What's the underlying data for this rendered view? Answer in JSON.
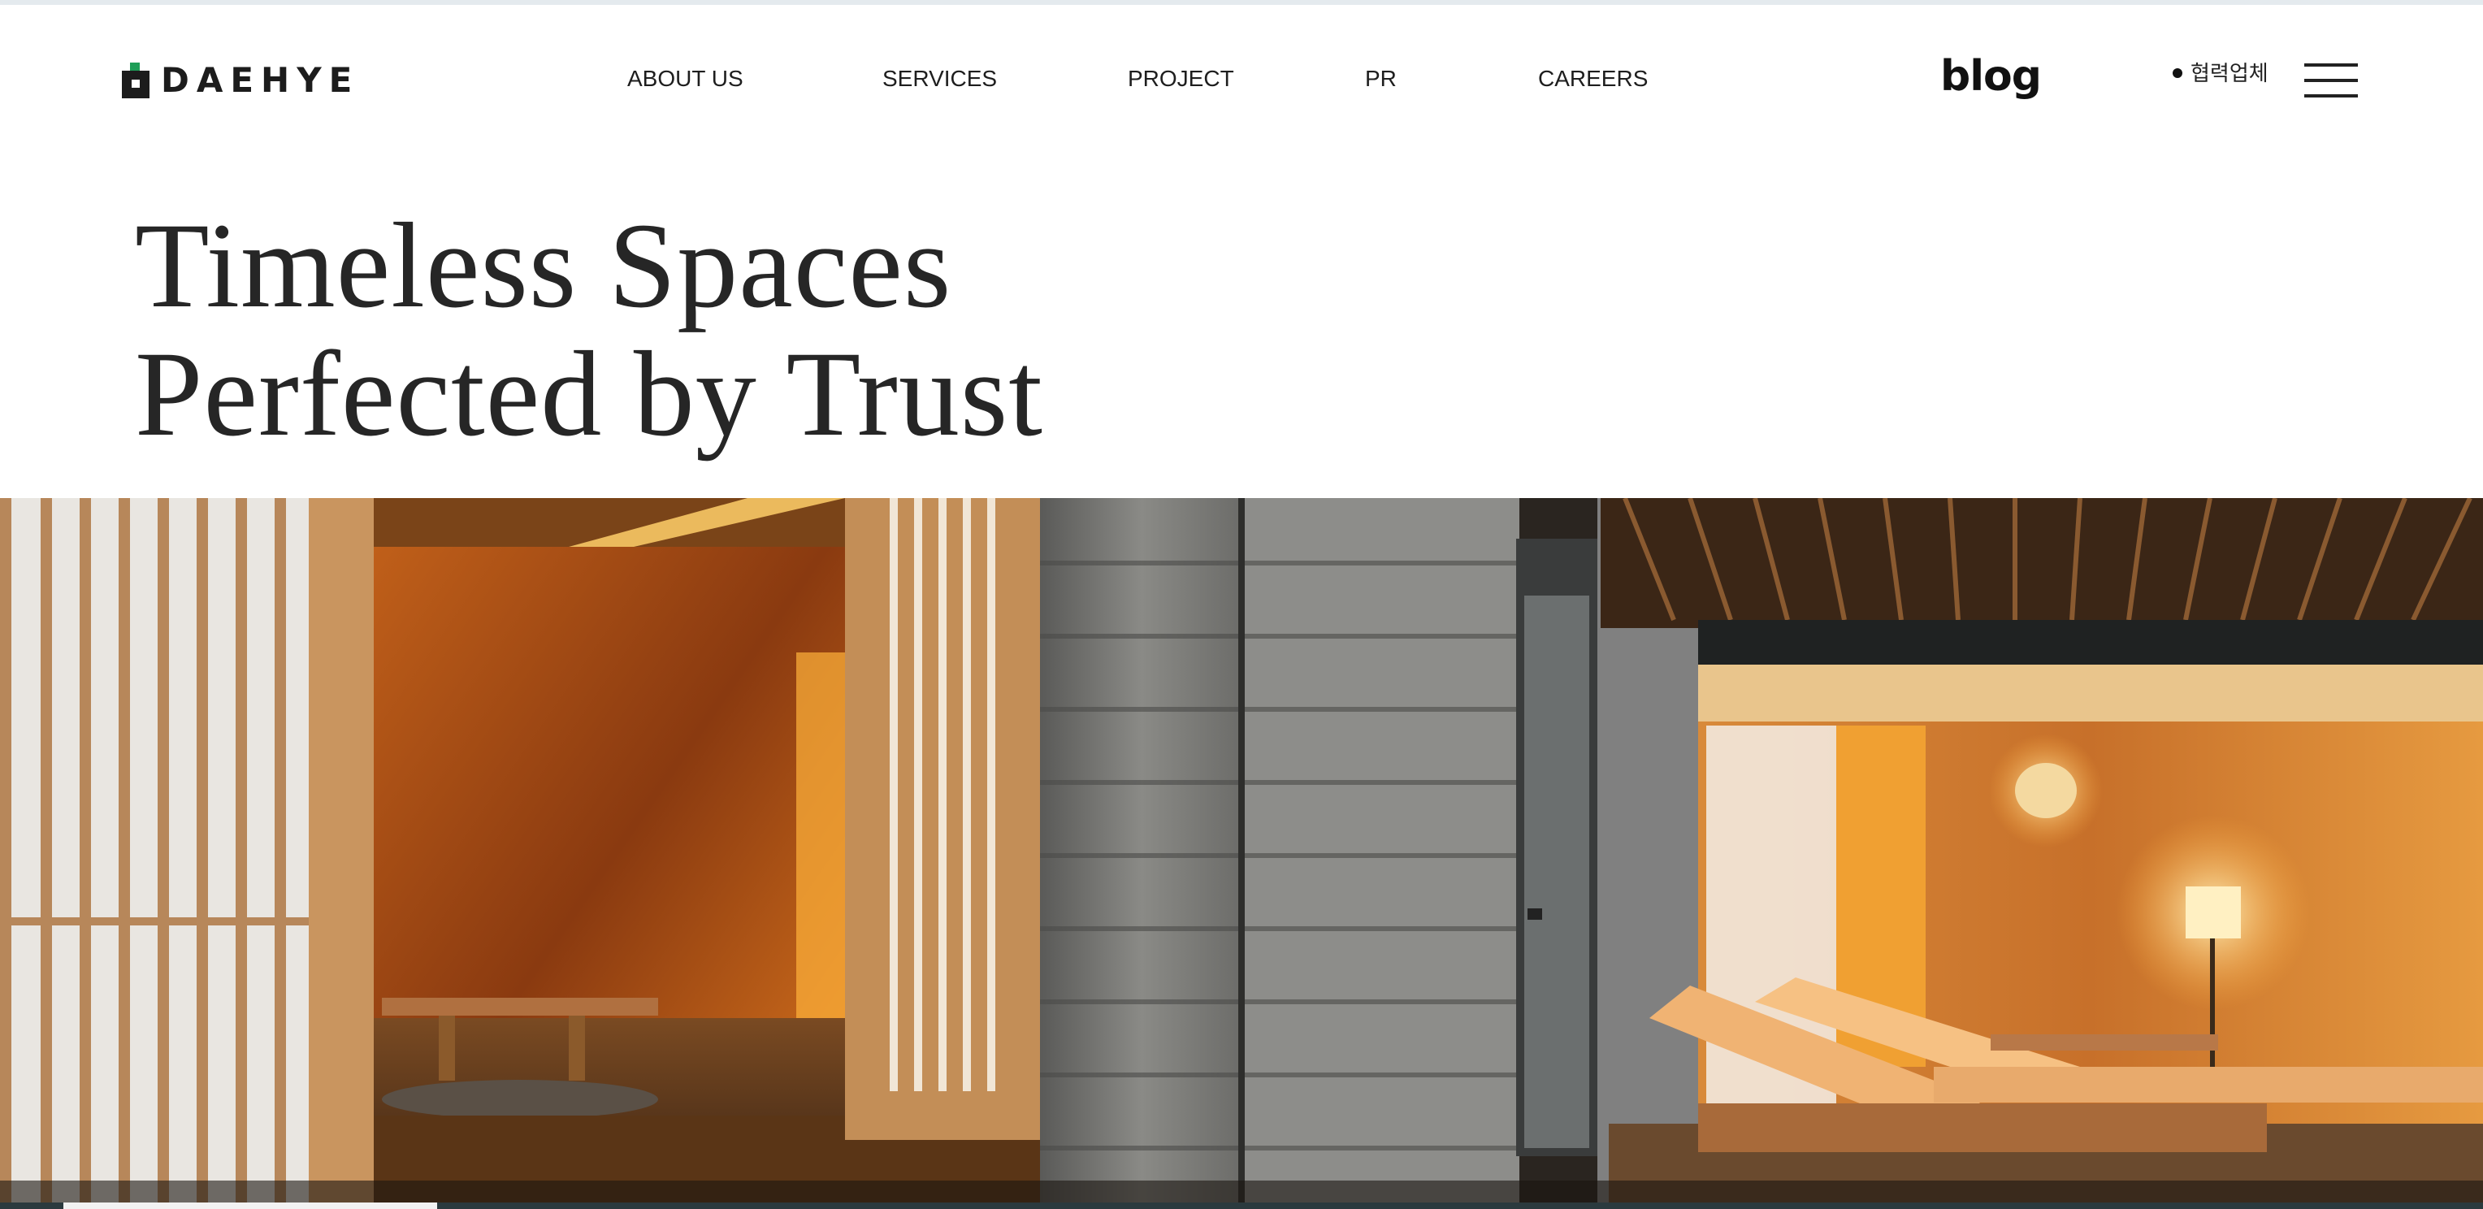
{
  "brand": {
    "name": "DAEHYE",
    "accent_color": "#1e9e57"
  },
  "nav": {
    "items": [
      {
        "label": "ABOUT US"
      },
      {
        "label": "SERVICES"
      },
      {
        "label": "PROJECT"
      },
      {
        "label": "PR"
      },
      {
        "label": "CAREERS"
      }
    ]
  },
  "header_actions": {
    "blog_label": "blog",
    "partner_label": "협력업체",
    "menu_icon": "hamburger-menu-icon"
  },
  "hero": {
    "title_line1": "Timeless Spaces",
    "title_line2": "Perfected by Trust",
    "image_description_icon": "interior-photo"
  },
  "slider": {
    "progress_fraction": 0.15
  }
}
